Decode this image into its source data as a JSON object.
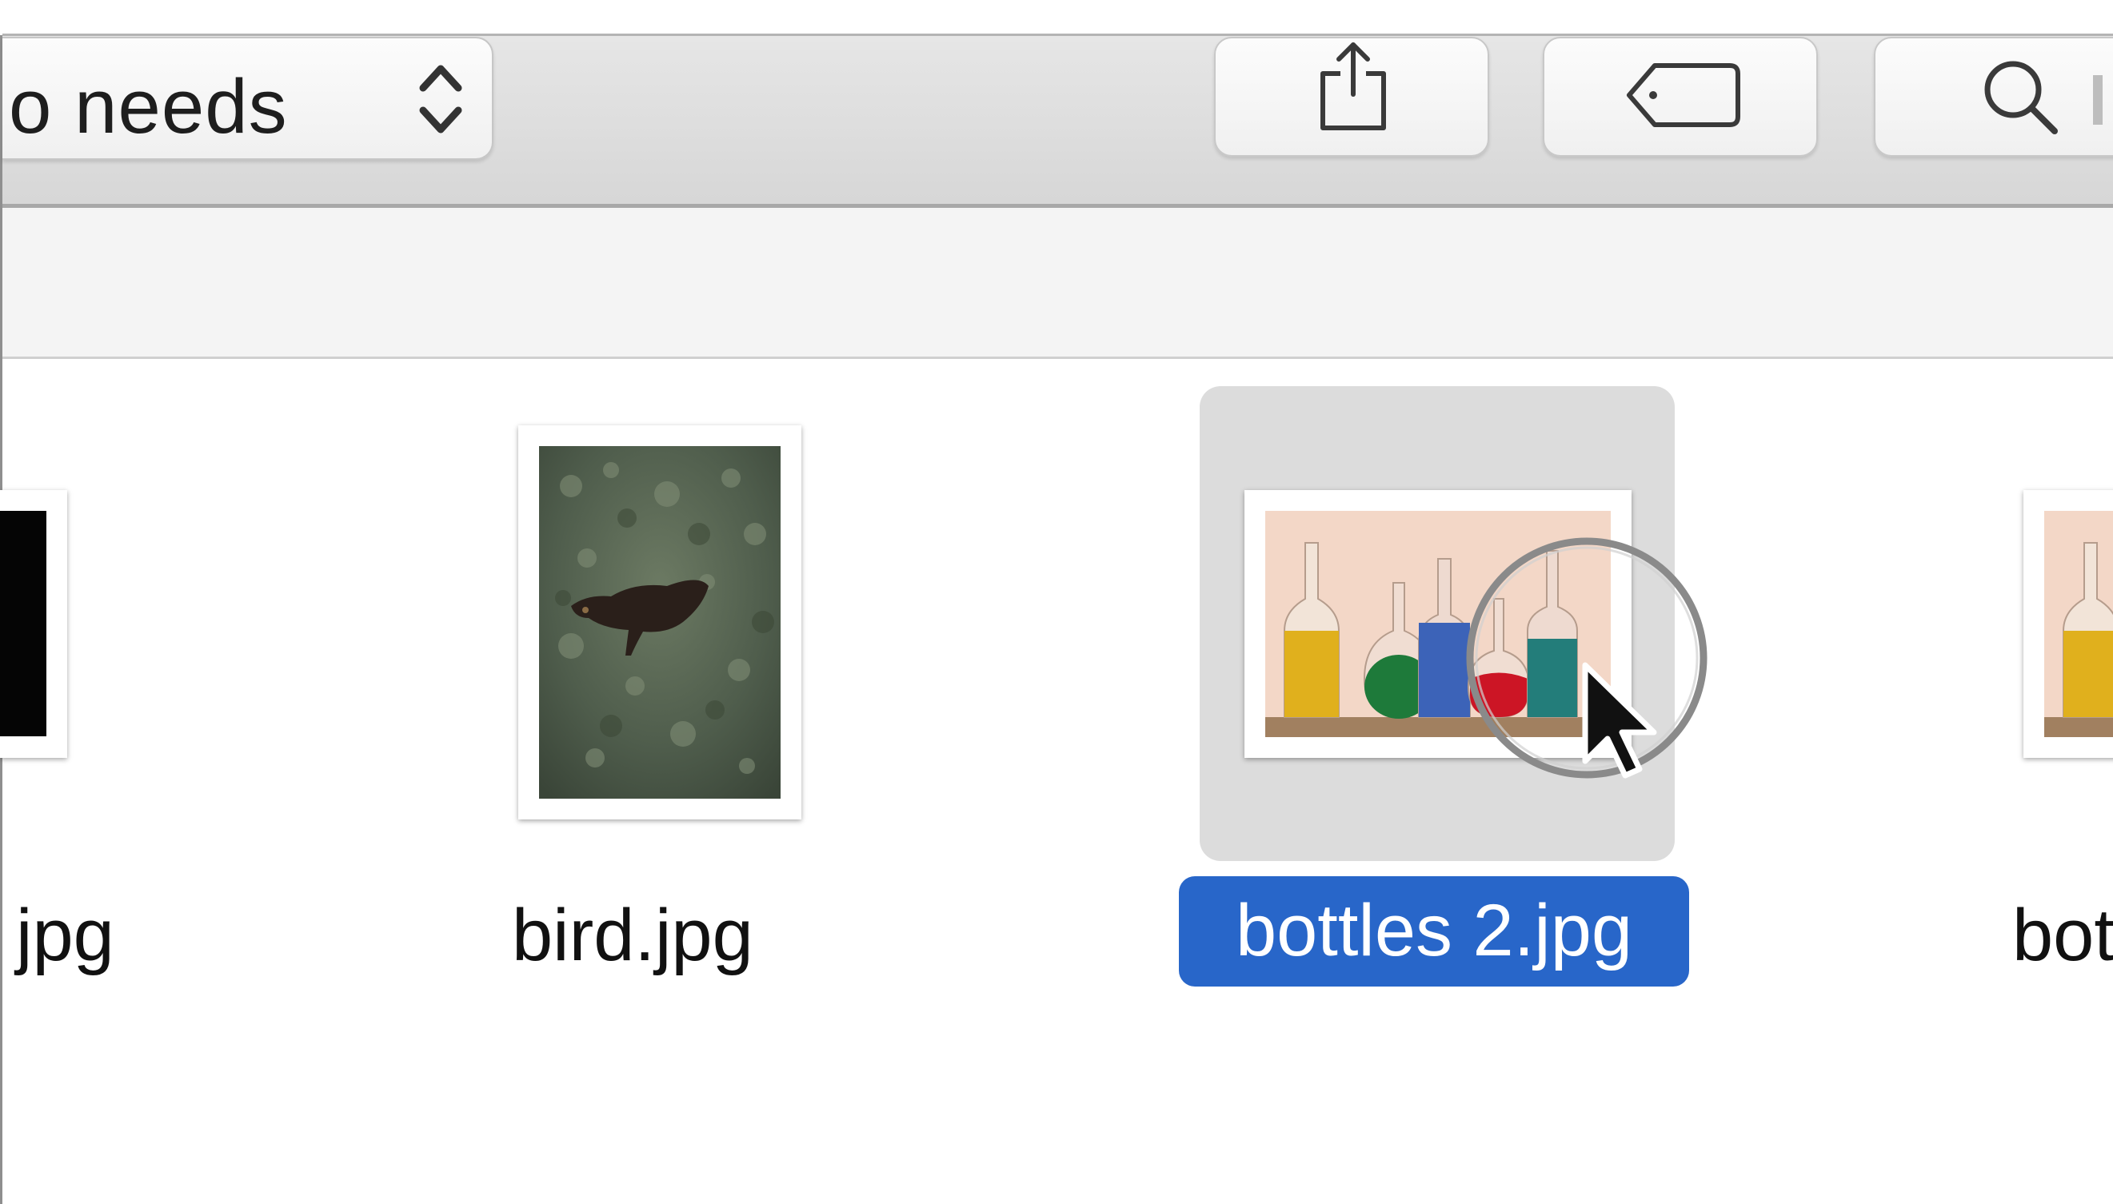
{
  "toolbar": {
    "arrange_label": "o needs",
    "buttons": [
      {
        "name": "share",
        "icon": "share-icon"
      },
      {
        "name": "tags",
        "icon": "tag-icon"
      },
      {
        "name": "search",
        "icon": "search-icon"
      }
    ]
  },
  "files": [
    {
      "label": "jpg",
      "selected": false
    },
    {
      "label": "bird.jpg",
      "selected": false
    },
    {
      "label": "bottles 2.jpg",
      "selected": true
    },
    {
      "label": "bot",
      "selected": false
    }
  ],
  "colors": {
    "selection_blue": "#2866c9",
    "selection_gray": "#dcdcdc"
  }
}
